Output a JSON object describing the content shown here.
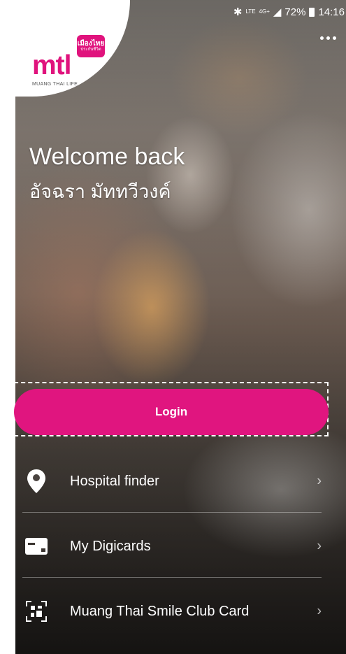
{
  "status_bar": {
    "left_dots": "...",
    "network": "LTE",
    "network_small": "4G+",
    "battery": "72%",
    "time": "14:16"
  },
  "brand": {
    "logo_text": "mtl",
    "badge_text": "เมืองไทย",
    "badge_sub": "ประกันชีวิต",
    "sub_text": "MUANG THAI LIFE",
    "color": "#e0137d"
  },
  "welcome": {
    "greeting": "Welcome back",
    "username": "อัจฉรา มัททวีวงค์"
  },
  "login": {
    "label": "Login",
    "color": "#e0157f"
  },
  "menu": {
    "items": [
      {
        "label": "Hospital finder",
        "icon": "location-pin-icon"
      },
      {
        "label": "My Digicards",
        "icon": "card-icon"
      },
      {
        "label": "Muang Thai Smile Club Card",
        "icon": "qr-code-icon"
      }
    ],
    "chevron": "›"
  }
}
